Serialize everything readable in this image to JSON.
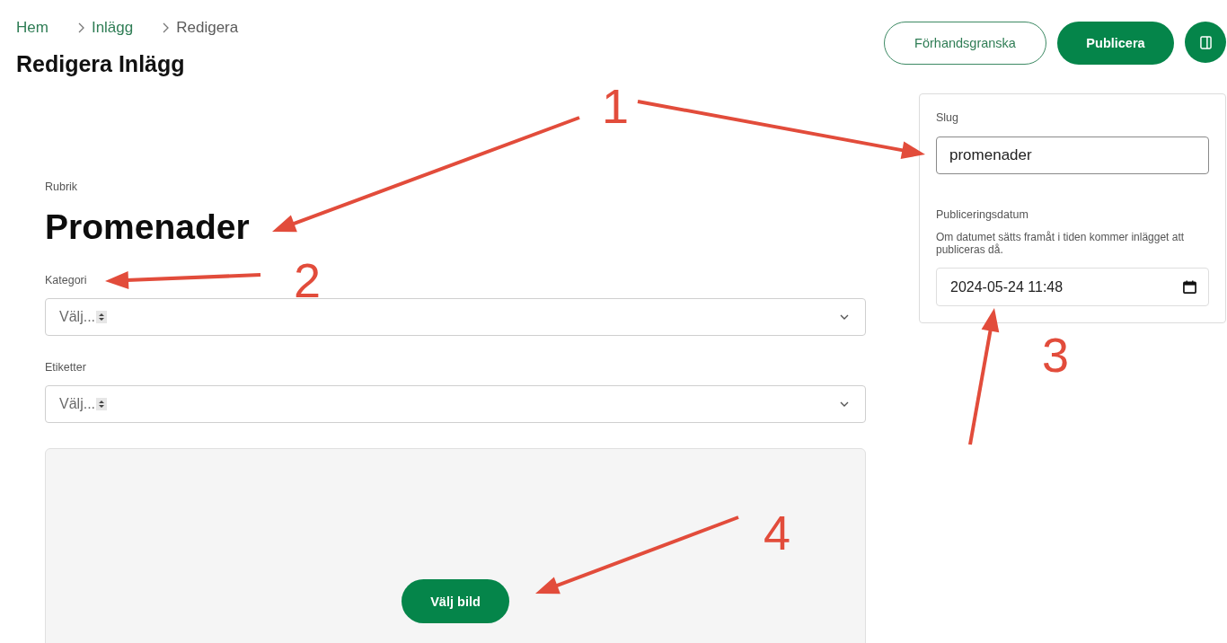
{
  "breadcrumb": [
    {
      "label": "Hem",
      "kind": "link"
    },
    {
      "label": "Inlägg",
      "kind": "link"
    },
    {
      "label": "Redigera",
      "kind": "current"
    }
  ],
  "page_title": "Redigera Inlägg",
  "toolbar": {
    "buttons": [
      {
        "label": "Förhandsgranska",
        "kind": "outline"
      },
      {
        "label": "Publicera",
        "kind": "primary"
      },
      {
        "kind": "icon"
      }
    ]
  },
  "form": {
    "title": {
      "label": "Rubrik",
      "value": "Promenader"
    },
    "selects": [
      {
        "label": "Kategori",
        "placeholder": "Välj..."
      },
      {
        "label": "Etiketter",
        "placeholder": "Välj..."
      }
    ],
    "image": {
      "button": "Välj bild"
    }
  },
  "settings_panel": {
    "slug": {
      "label": "Slug",
      "value": "promenader"
    },
    "publish_date": {
      "label": "Publiceringsdatum",
      "help": "Om datumet sätts framåt i tiden kommer inlägget att publiceras då.",
      "value": "2024-05-24 11:48"
    }
  },
  "annotations": [
    {
      "label": "1"
    },
    {
      "label": "2"
    },
    {
      "label": "3"
    },
    {
      "label": "4"
    }
  ]
}
